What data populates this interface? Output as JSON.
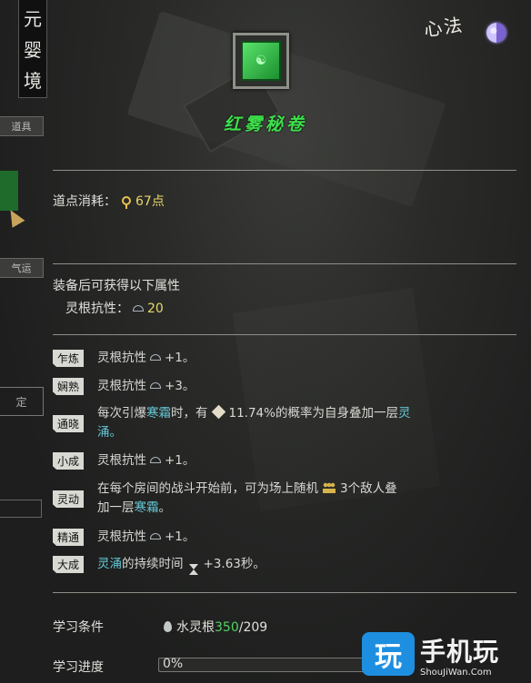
{
  "realm": {
    "chars": [
      "元",
      "婴",
      "境"
    ]
  },
  "left_strip": {
    "tab1": "道具",
    "tab2": "气运",
    "button": "定"
  },
  "header": {
    "category": "心法",
    "category_icon": "yin-yang-icon"
  },
  "item": {
    "title": "红雾秘卷",
    "icon": "green-book-icon",
    "title_color": "#3ce04a"
  },
  "cost": {
    "label": "道点消耗：",
    "value": "67点",
    "icon": "dao-point-icon"
  },
  "equip": {
    "header": "装备后可获得以下属性",
    "stat_label": "灵根抗性：",
    "stat_value": "20",
    "stat_icon": "spirit-root-resist-icon"
  },
  "traits": [
    {
      "tag": "乍炼",
      "text": "灵根抗性",
      "suffix": "+1。",
      "color": "#d8d8d4"
    },
    {
      "tag": "娴熟",
      "text": "灵根抗性",
      "suffix": "+3。",
      "color": "#52d462"
    },
    {
      "tag": "通晓",
      "line1_a": "每次引爆",
      "line1_b": "寒霜",
      "line1_c": "时，有",
      "line1_d": "11.74%的概率为自身叠加一层",
      "line1_e": "灵",
      "line2": "涌。"
    },
    {
      "tag": "小成",
      "text": "灵根抗性",
      "suffix": "+1。"
    },
    {
      "tag": "灵动",
      "line1_a": "在每个房间的战斗开始前，可为场上随机",
      "line1_b": "3个敌人叠",
      "line2_a": "加一层",
      "line2_b": "寒霜",
      "line2_c": "。"
    },
    {
      "tag": "精通",
      "text": "灵根抗性",
      "suffix": "+1。"
    },
    {
      "tag": "大成",
      "text_a": "灵涌",
      "text_b": "的持续时间",
      "suffix": "+3.63秒。"
    }
  ],
  "requirement": {
    "label": "学习条件",
    "root_name": "水灵根",
    "current": "350",
    "required": "/209"
  },
  "progress": {
    "label": "学习进度",
    "value": "0%",
    "fraction": 0
  },
  "watermark": {
    "brand": "手机玩",
    "logo": "玩",
    "url": "ShouJiWan.Com"
  },
  "colors": {
    "green": "#52d462",
    "cyan": "#66c8d6",
    "yellow": "#e8d86a"
  }
}
